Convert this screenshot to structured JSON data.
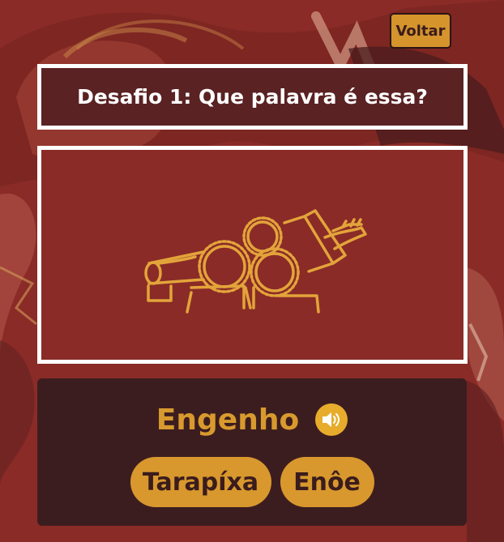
{
  "header": {
    "back_label": "Voltar"
  },
  "challenge": {
    "title": "Desafio 1: Que palavra é essa?"
  },
  "answer": {
    "word": "Engenho"
  },
  "options": [
    {
      "label": "Tarapíxa"
    },
    {
      "label": "Enôe"
    }
  ],
  "colors": {
    "background": "#8a2b27",
    "accent": "#d8982d",
    "panel": "#3c1d1f",
    "title_box": "#5a2223",
    "border": "#ffffff"
  },
  "icons": {
    "speaker": "speaker-icon",
    "illustration": "sugar-mill-engine-illustration"
  }
}
